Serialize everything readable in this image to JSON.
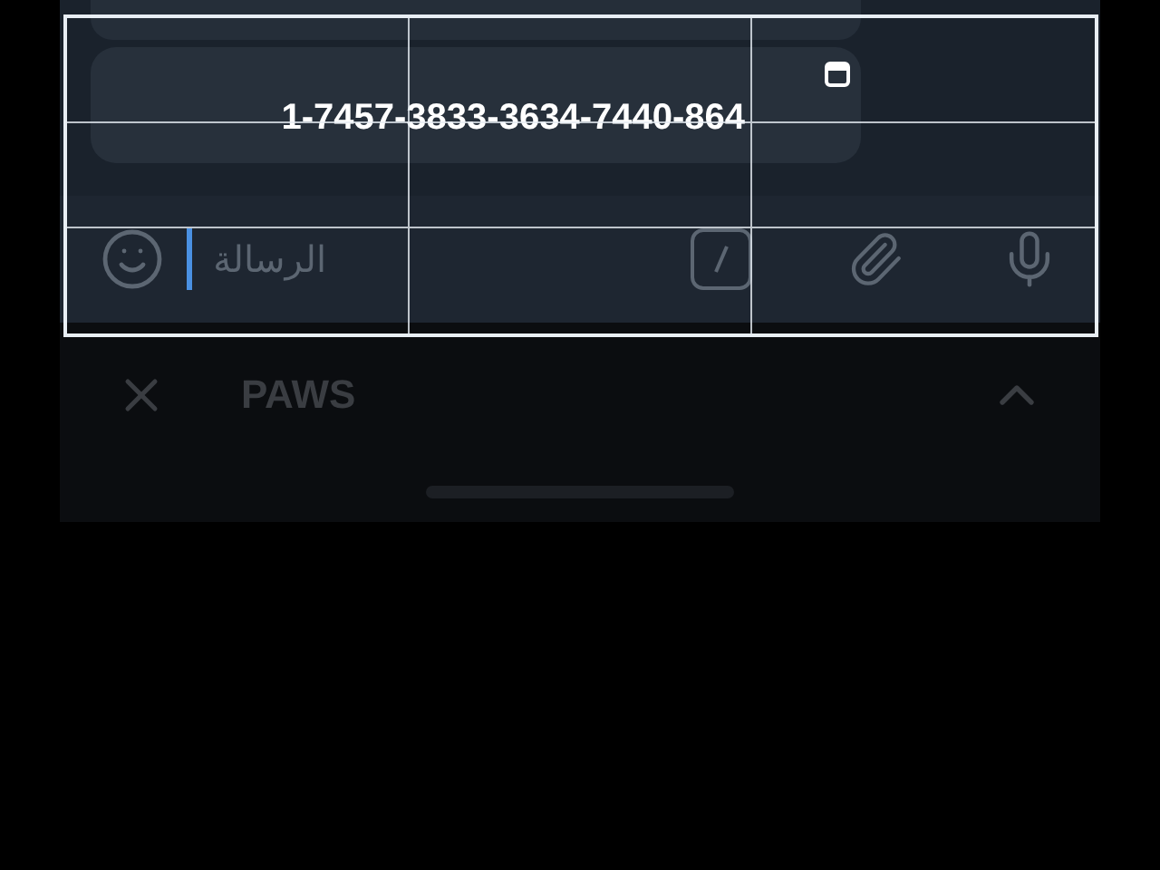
{
  "message": {
    "text": "1-7457-3833-3634-7440-864"
  },
  "composer": {
    "placeholder": "الرسالة"
  },
  "bottom_bar": {
    "title": "PAWS"
  }
}
